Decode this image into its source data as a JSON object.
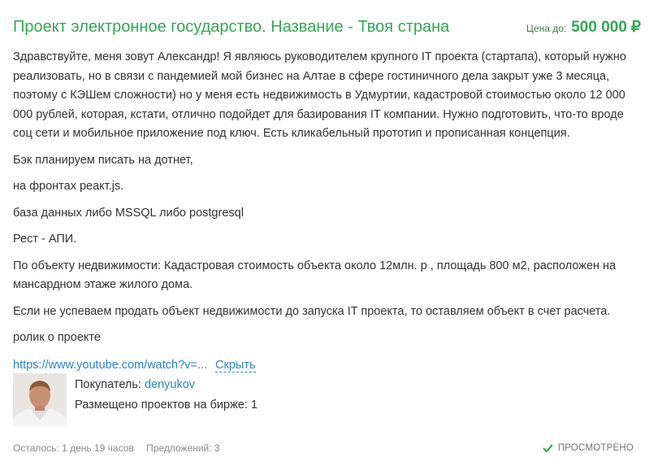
{
  "project": {
    "title": "Проект электронное государство. Название - Твоя страна",
    "price_label": "Цена до:",
    "price_value": "500 000",
    "currency_symbol": "₽"
  },
  "description": {
    "paragraphs": [
      "Здравствуйте, меня зовут Александр! Я являюсь руководителем крупного IT проекта (стартапа), который нужно реализовать, но в связи с пандемией мой бизнес на Алтае в сфере гостиничного дела закрыт уже 3 месяца, поэтому с КЭШем сложности) но у меня есть недвижимость в Удмуртии, кадастровой стоимостью около 12 000 000 рублей, которая, кстати, отлично подойдет для базирования IT компании. Нужно подготовить, что-то вроде соц сети и мобильное приложение под ключ. Есть кликабельный прототип и прописанная концепция.",
      "Бэк планируем писать на дотнет,",
      "на фронтах реакт.js.",
      "база данных либо MSSQL либо postgresql",
      "Рест - АПИ.",
      "По объекту недвижимости: Кадастровая стоимость объекта около 12млн. р , площадь 800 м2, расположен на мансардном этаже жилого дома.",
      "Если не успеваем продать объект недвижимости до запуска IT проекта, то оставляем объект в счет расчета.",
      "ролик о проекте"
    ],
    "link_text": "https://www.youtube.com/watch?v=...",
    "hide_label": "Скрыть"
  },
  "buyer": {
    "label": "Покупатель:",
    "name": "denyukov",
    "projects_label": "Размещено проектов на бирже:",
    "projects_count": "1",
    "avatar_icon": "user-avatar-photo"
  },
  "footer": {
    "time_left": "Осталось: 1 день 19 часов",
    "offers": "Предложений: 3",
    "viewed_label": "ПРОСМОТРЕНО",
    "viewed_icon": "checkmark-icon"
  },
  "colors": {
    "accent_green": "#33a853",
    "link_blue": "#2e84c9",
    "text": "#333333",
    "muted": "#888888"
  }
}
